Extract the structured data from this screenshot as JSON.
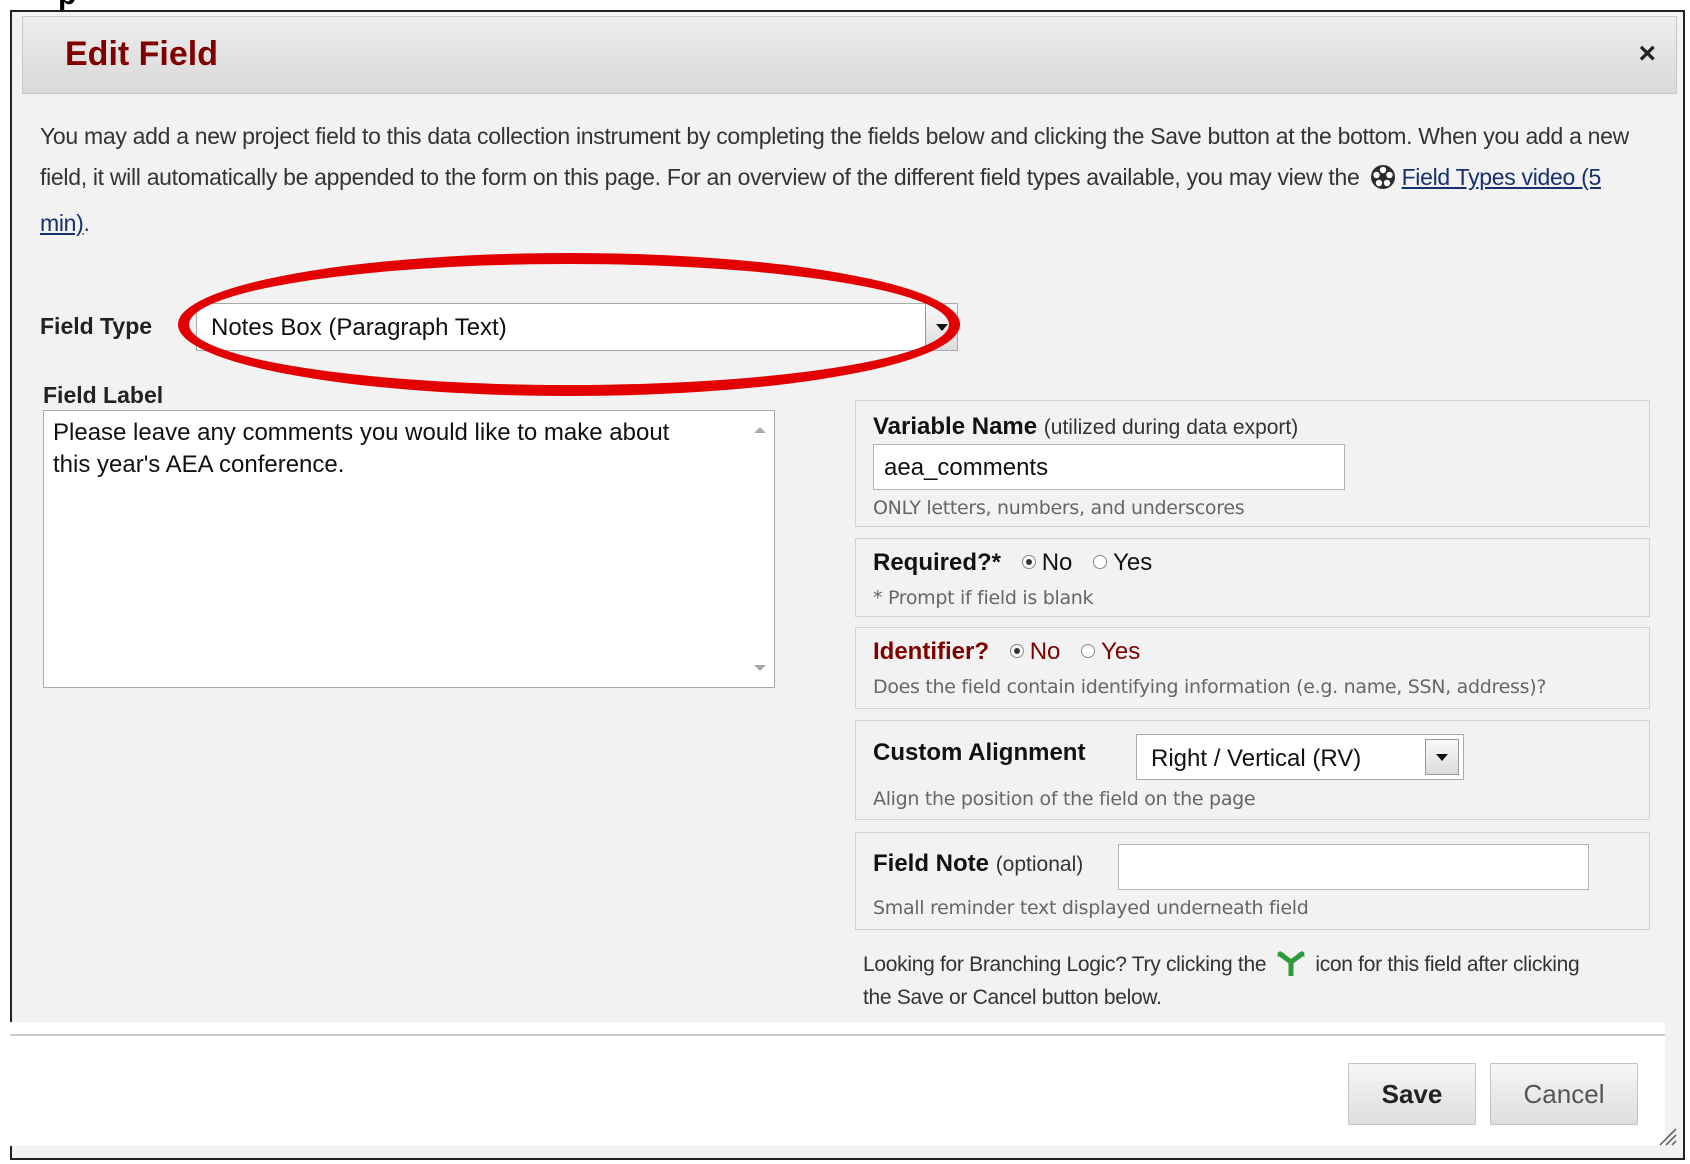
{
  "dialog": {
    "title": "Edit Field",
    "close_label": "×",
    "intro_text": "You may add a new project field to this data collection instrument by completing the fields below and clicking the Save button at the bottom. When you add a new field, it will automatically be appended to the form on this page. For an overview of the different field types available, you may view the",
    "intro_link": "Field Types video (5 min)",
    "intro_end": "."
  },
  "field_type": {
    "label": "Field Type",
    "value": "Notes Box (Paragraph Text)"
  },
  "field_label": {
    "label": "Field Label",
    "value": "Please leave any comments you would like to make about this year's AEA conference."
  },
  "variable_name": {
    "title": "Variable Name",
    "subtitle": "(utilized during data export)",
    "value": "aea_comments",
    "hint": "ONLY letters, numbers, and underscores"
  },
  "required": {
    "title": "Required?*",
    "options": [
      "No",
      "Yes"
    ],
    "selected": "No",
    "hint": "* Prompt if field is blank"
  },
  "identifier": {
    "title": "Identifier?",
    "options": [
      "No",
      "Yes"
    ],
    "selected": "No",
    "hint": "Does the field contain identifying information (e.g. name, SSN, address)?"
  },
  "custom_alignment": {
    "title": "Custom Alignment",
    "value": "Right / Vertical (RV)",
    "hint": "Align the position of the field on the page"
  },
  "field_note": {
    "title": "Field Note",
    "subtitle": "(optional)",
    "value": "",
    "hint": "Small reminder text displayed underneath field"
  },
  "branching": {
    "text_before": "Looking for Branching Logic? Try clicking the",
    "text_after": "icon for this field after clicking the Save or Cancel button below."
  },
  "buttons": {
    "save": "Save",
    "cancel": "Cancel"
  },
  "colors": {
    "title": "#800000",
    "annotation": "#e20000",
    "link": "#16306e",
    "branch_icon": "#2e9a3a"
  },
  "icons": [
    "close-icon",
    "film-reel-icon",
    "dropdown-arrow-icon",
    "branching-logic-icon",
    "resize-grip-icon"
  ]
}
